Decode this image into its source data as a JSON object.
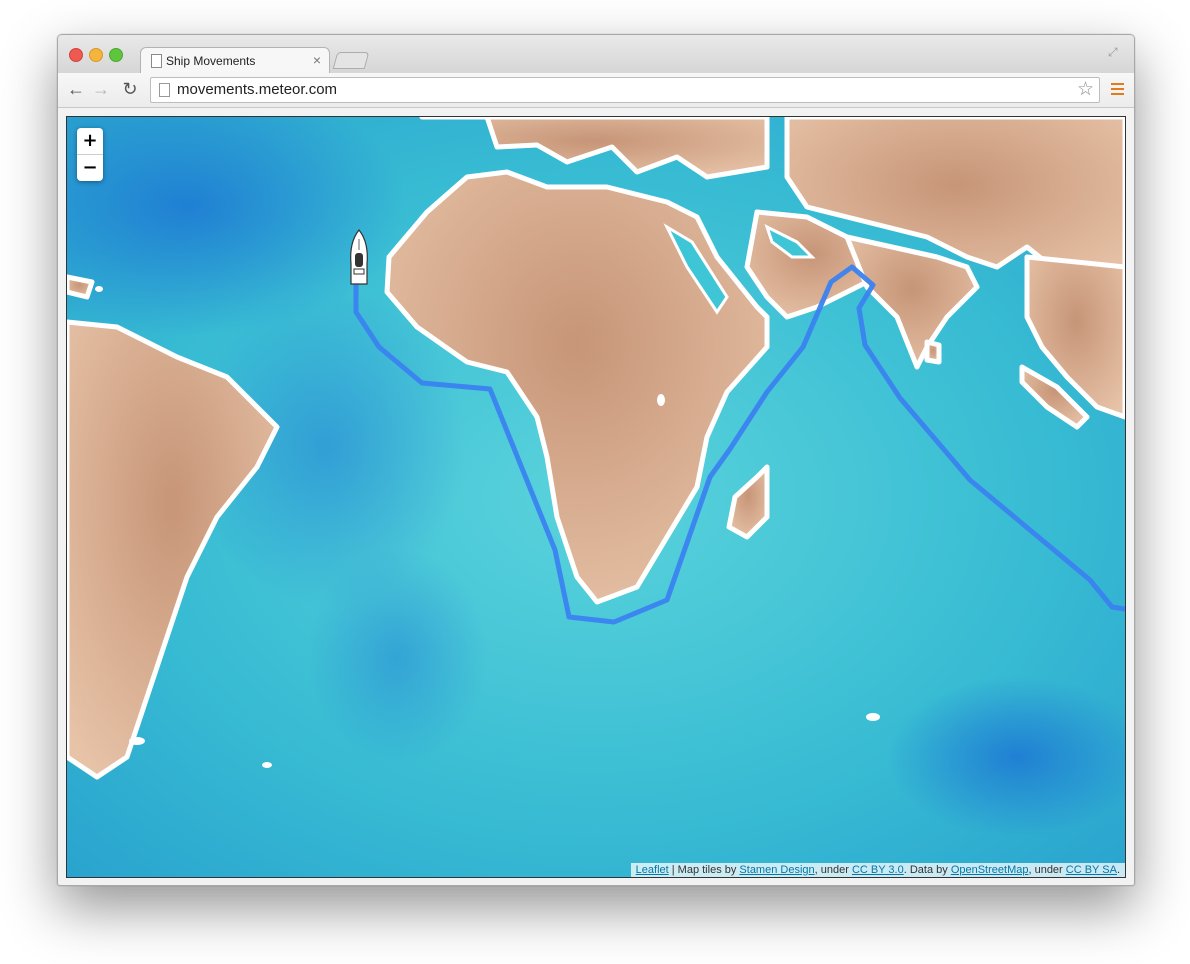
{
  "browser": {
    "tab_title": "Ship Movements",
    "tab_close": "×",
    "url": "movements.meteor.com",
    "back_glyph": "←",
    "forward_glyph": "→",
    "reload_glyph": "↻",
    "star_glyph": "☆",
    "fullscreen_glyph": "⤢"
  },
  "map": {
    "zoom_in": "+",
    "zoom_out": "−",
    "ocean_color": "#3fc6d6",
    "land_color": "#d9a98a",
    "route_color": "#3b82f0",
    "marker": "ship-icon"
  },
  "attribution": {
    "leaflet": "Leaflet",
    "sep1": " | Map tiles by ",
    "stamen": "Stamen Design",
    "sep2": ", under ",
    "cc_by": "CC BY 3.0",
    "sep3": ". Data by ",
    "osm": "OpenStreetMap",
    "sep4": ", under ",
    "cc_by_sa": "CC BY SA",
    "end": "."
  }
}
